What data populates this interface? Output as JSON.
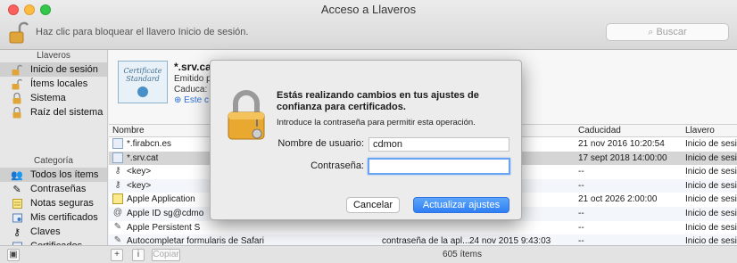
{
  "window": {
    "title": "Acceso a Llaveros"
  },
  "toolbar": {
    "lock_hint": "Haz clic para bloquear el llavero Inicio de sesión.",
    "search_placeholder": "Buscar"
  },
  "sidebar": {
    "keychains_header": "Llaveros",
    "keychains": [
      {
        "label": "Inicio de sesión",
        "icon": "lock-open-icon",
        "selected": true
      },
      {
        "label": "Ítems locales",
        "icon": "lock-open-icon",
        "selected": false
      },
      {
        "label": "Sistema",
        "icon": "lock-icon",
        "selected": false
      },
      {
        "label": "Raíz del sistema",
        "icon": "lock-icon",
        "selected": false
      }
    ],
    "category_header": "Categoría",
    "categories": [
      {
        "label": "Todos los ítems",
        "icon": "people-icon",
        "selected": true
      },
      {
        "label": "Contraseñas",
        "icon": "pen-icon",
        "selected": false
      },
      {
        "label": "Notas seguras",
        "icon": "note-icon",
        "selected": false
      },
      {
        "label": "Mis certificados",
        "icon": "certificate-icon",
        "selected": false
      },
      {
        "label": "Claves",
        "icon": "key-icon",
        "selected": false
      },
      {
        "label": "Certificados",
        "icon": "certificate-icon",
        "selected": false
      }
    ]
  },
  "detail": {
    "cert_text_1": "Certificate",
    "cert_text_2": "Standard",
    "name": "*.srv.ca",
    "issued_by": "Emitido p",
    "expires": "Caduca:",
    "trust": "Este c"
  },
  "table": {
    "columns": {
      "name": "Nombre",
      "expires": "Caducidad",
      "keychain": "Llavero"
    },
    "rows": [
      {
        "icon": "certificate-icon",
        "name": "*.firabcn.es",
        "kind": "",
        "modified": "",
        "expires": "21 nov 2016 10:20:54",
        "keychain": "Inicio de sesi..."
      },
      {
        "icon": "certificate-icon",
        "name": "*.srv.cat",
        "kind": "",
        "modified": "",
        "expires": "17 sept 2018 14:00:00",
        "keychain": "Inicio de sesi..."
      },
      {
        "icon": "key-icon",
        "name": "<key>",
        "kind": "",
        "modified": "",
        "expires": "--",
        "keychain": "Inicio de sesi..."
      },
      {
        "icon": "key-icon",
        "name": "<key>",
        "kind": "",
        "modified": "",
        "expires": "--",
        "keychain": "Inicio de sesi..."
      },
      {
        "icon": "note-icon",
        "name": "Apple Application",
        "kind": "",
        "modified": "",
        "expires": "21 oct 2026 2:00:00",
        "keychain": "Inicio de sesi..."
      },
      {
        "icon": "at-icon",
        "name": "Apple ID sg@cdmo",
        "kind": "",
        "modified": "",
        "expires": "--",
        "keychain": "Inicio de sesi..."
      },
      {
        "icon": "pen-icon",
        "name": "Apple Persistent S",
        "kind": "",
        "modified": "",
        "expires": "--",
        "keychain": "Inicio de sesi..."
      },
      {
        "icon": "pen-icon",
        "name": "Autocompletar formularis de Safari",
        "kind": "contraseña de la apl...",
        "modified": "24 nov 2015 9:43:03",
        "expires": "--",
        "keychain": "Inicio de sesi..."
      }
    ]
  },
  "statusbar": {
    "add_label": "+",
    "info_label": "i",
    "copy_label": "Copiar",
    "count": "605 ítems"
  },
  "modal": {
    "title": "Estás realizando cambios en tus ajustes de confianza para certificados.",
    "subtitle": "Introduce la contraseña para permitir esta operación.",
    "username_label": "Nombre de usuario:",
    "username_value": "cdmon",
    "password_label": "Contraseña:",
    "password_value": "",
    "cancel_label": "Cancelar",
    "ok_label": "Actualizar ajustes"
  },
  "colors": {
    "accent": "#2f7ff3",
    "selection": "#d5d5d5"
  }
}
